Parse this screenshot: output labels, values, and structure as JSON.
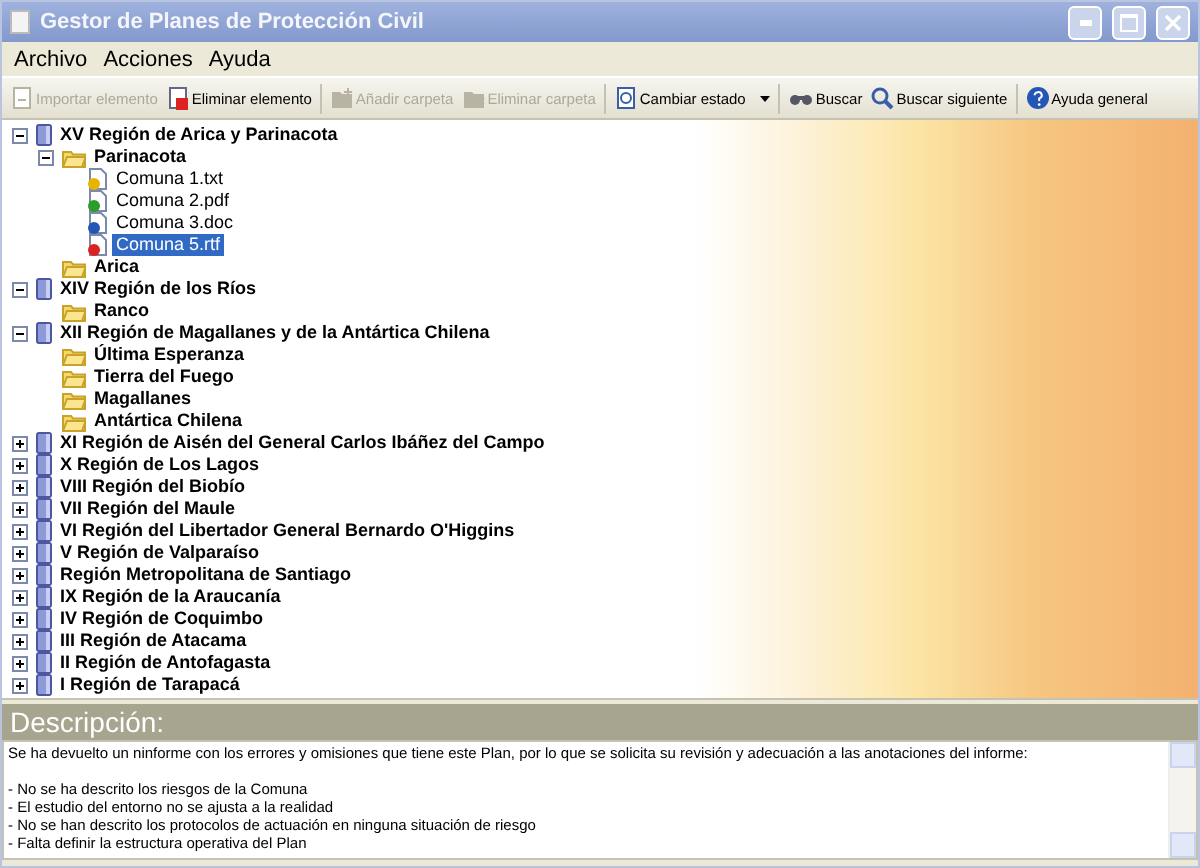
{
  "window": {
    "title": "Gestor de Planes de Protección Civil",
    "active": false
  },
  "menu": [
    "Archivo",
    "Acciones",
    "Ayuda"
  ],
  "toolbar": [
    [
      {
        "kind": "import",
        "label": "Importar elemento",
        "disabled": true
      },
      {
        "kind": "delete",
        "label": "Eliminar elemento",
        "disabled": false
      }
    ],
    [
      {
        "kind": "add-folder",
        "label": "Añadir carpeta",
        "disabled": true
      },
      {
        "kind": "delete-folder",
        "label": "Eliminar carpeta",
        "disabled": true
      }
    ],
    [
      {
        "kind": "state",
        "label": "Cambiar estado",
        "disabled": false,
        "dropdown": true
      }
    ],
    [
      {
        "kind": "search",
        "label": "Buscar",
        "disabled": false
      },
      {
        "kind": "search-next",
        "label": "Buscar siguiente",
        "disabled": false
      }
    ],
    [
      {
        "kind": "help",
        "label": "Ayuda general",
        "disabled": false
      }
    ]
  ],
  "tree": [
    {
      "kind": "region",
      "label": "XV Región de Arica y Parinacota",
      "expanded": true,
      "selected": false,
      "children": [
        {
          "kind": "folder",
          "label": "Parinacota",
          "expanded": true,
          "selected": false,
          "children": [
            {
              "kind": "file",
              "color": "#e8b400",
              "label": "Comuna 1.txt",
              "selected": false
            },
            {
              "kind": "file",
              "color": "#2a9d2a",
              "label": "Comuna 2.pdf",
              "selected": false
            },
            {
              "kind": "file",
              "color": "#2456b5",
              "label": "Comuna 3.doc",
              "selected": false
            },
            {
              "kind": "file",
              "color": "#dd2222",
              "label": "Comuna 5.rtf",
              "selected": true
            }
          ]
        },
        {
          "kind": "folder",
          "label": "Arica",
          "selected": false
        }
      ]
    },
    {
      "kind": "region",
      "label": "XIV Región de los Ríos",
      "expanded": true,
      "selected": false,
      "children": [
        {
          "kind": "folder",
          "label": "Ranco",
          "selected": false
        }
      ]
    },
    {
      "kind": "region",
      "label": "XII Región de Magallanes y de la Antártica Chilena",
      "expanded": true,
      "selected": false,
      "children": [
        {
          "kind": "folder",
          "label": "Última Esperanza",
          "selected": false
        },
        {
          "kind": "folder",
          "label": "Tierra del Fuego",
          "selected": false
        },
        {
          "kind": "folder",
          "label": "Magallanes",
          "selected": false
        },
        {
          "kind": "folder",
          "label": "Antártica Chilena",
          "selected": false
        }
      ]
    },
    {
      "kind": "region",
      "label": "XI Región de Aisén del General Carlos Ibáñez del Campo",
      "expanded": false,
      "selected": false
    },
    {
      "kind": "region",
      "label": "X Región de Los Lagos",
      "expanded": false,
      "selected": false
    },
    {
      "kind": "region",
      "label": "VIII Región del Biobío",
      "expanded": false,
      "selected": false
    },
    {
      "kind": "region",
      "label": "VII Región del Maule",
      "expanded": false,
      "selected": false
    },
    {
      "kind": "region",
      "label": "VI Región del Libertador General Bernardo O'Higgins",
      "expanded": false,
      "selected": false
    },
    {
      "kind": "region",
      "label": "V Región de Valparaíso",
      "expanded": false,
      "selected": false
    },
    {
      "kind": "region",
      "label": "Región Metropolitana de Santiago",
      "expanded": false,
      "selected": false
    },
    {
      "kind": "region",
      "label": "IX Región de la Araucanía",
      "expanded": false,
      "selected": false
    },
    {
      "kind": "region",
      "label": "IV Región  de Coquimbo",
      "expanded": false,
      "selected": false
    },
    {
      "kind": "region",
      "label": "III Región de Atacama",
      "expanded": false,
      "selected": false
    },
    {
      "kind": "region",
      "label": "II Región de Antofagasta",
      "expanded": false,
      "selected": false
    },
    {
      "kind": "region",
      "label": "I Región de Tarapacá",
      "expanded": false,
      "selected": false
    }
  ],
  "description": {
    "title": "Descripción:",
    "intro": "Se ha devuelto un ninforme con los errores y omisiones que tiene este Plan, por lo que se solicita su revisión y adecuación a las anotaciones del informe:",
    "items": [
      "- No se ha descrito los riesgos de la Comuna",
      "- El estudio del entorno no se ajusta a la realidad",
      "- No se han descrito los protocolos de actuación en ninguna situación de riesgo",
      "- Falta definir la estructura operativa del Plan"
    ]
  }
}
